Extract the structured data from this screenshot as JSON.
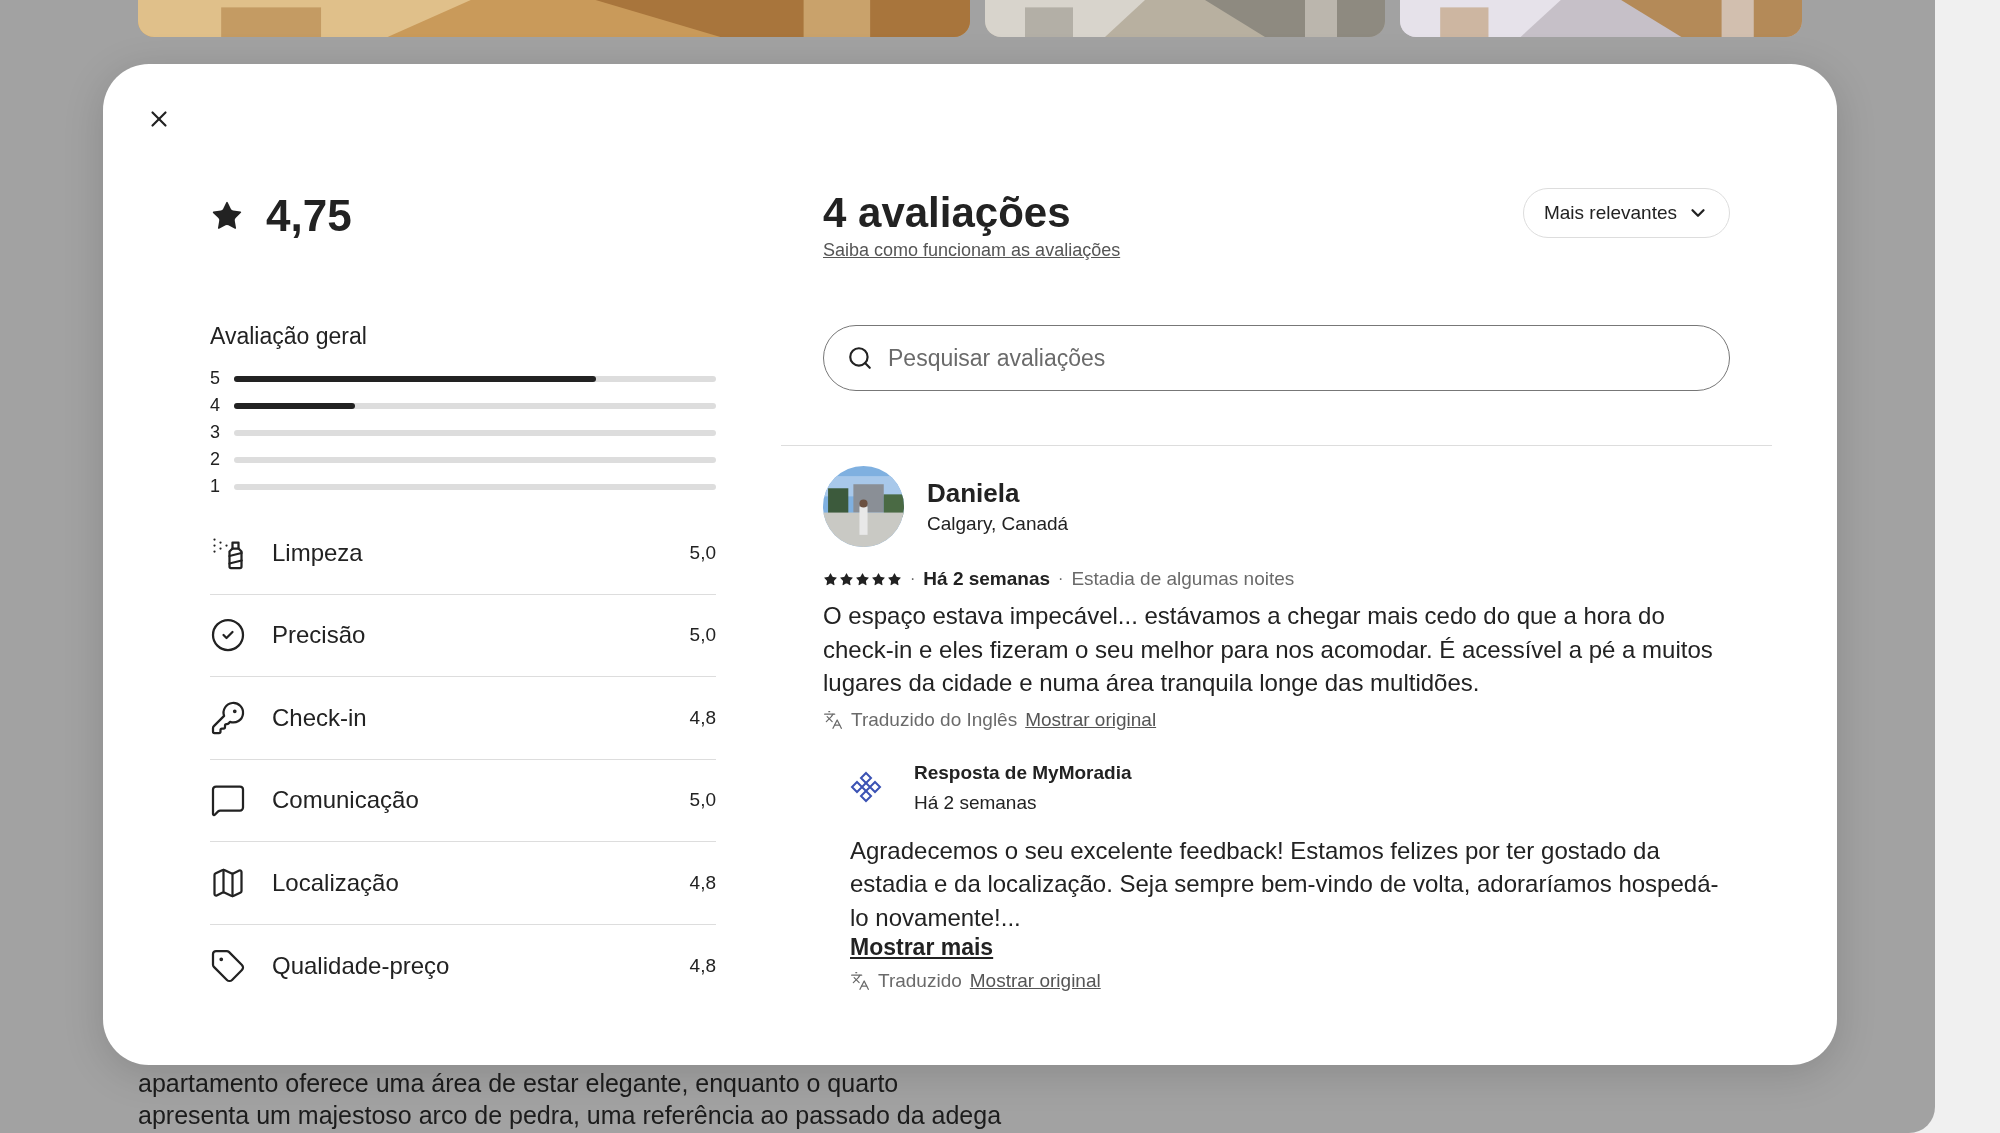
{
  "background_page": {
    "photos": [
      {
        "kind": "picture"
      },
      {
        "kind": "picture"
      },
      {
        "kind": "picture"
      }
    ],
    "description_lines": [
      "apartamento oferece uma área de estar elegante, enquanto o quarto",
      "apresenta um majestoso arco de pedra, uma referência ao passado da adega"
    ]
  },
  "modal": {
    "rating": "4,75",
    "overall_label": "Avaliação geral",
    "distribution": [
      {
        "label": "5",
        "level": 0.75
      },
      {
        "label": "4",
        "level": 0.25
      },
      {
        "label": "3",
        "level": 0
      },
      {
        "label": "2",
        "level": 0
      },
      {
        "label": "1",
        "level": 0
      }
    ],
    "categories": [
      {
        "kind": "cleaning",
        "label": "Limpeza",
        "score": "5,0"
      },
      {
        "kind": "accuracy",
        "label": "Precisão",
        "score": "5,0"
      },
      {
        "kind": "checkin",
        "label": "Check-in",
        "score": "4,8"
      },
      {
        "kind": "communication",
        "label": "Comunicação",
        "score": "5,0"
      },
      {
        "kind": "location",
        "label": "Localização",
        "score": "4,8"
      },
      {
        "kind": "value",
        "label": "Qualidade-preço",
        "score": "4,8"
      }
    ],
    "reviews_title": "4 avaliações",
    "reviews_link": "Saiba como funcionam as avaliações",
    "sort": "Mais relevantes",
    "search": {
      "placeholder": "Pesquisar avaliações"
    },
    "reviews": [
      {
        "name": "Daniela",
        "location": "Calgary, Canadá",
        "stars": 5,
        "separator": "·",
        "date": "Há 2 semanas",
        "stay": "Estadia de algumas noites",
        "text": "O espaço estava impecável... estávamos a chegar mais cedo do que a hora do check-in e eles fizeram o seu melhor para nos acomodar. É acessível a pé a muitos lugares da cidade e numa área tranquila longe das multidões.",
        "translation_note": "Traduzido do Inglês",
        "show_original": "Mostrar original",
        "reply": {
          "title": "Resposta de MyMoradia",
          "date": "Há 2 semanas",
          "text": "Agradecemos o seu excelente feedback! Estamos felizes por ter gostado da estadia e da localização. Seja sempre bem-vindo de volta, adoraríamos hospedá-lo novamente!...",
          "show_more": "Mostrar mais",
          "translation_note": "Traduzido",
          "show_original": "Mostrar original"
        }
      }
    ]
  }
}
